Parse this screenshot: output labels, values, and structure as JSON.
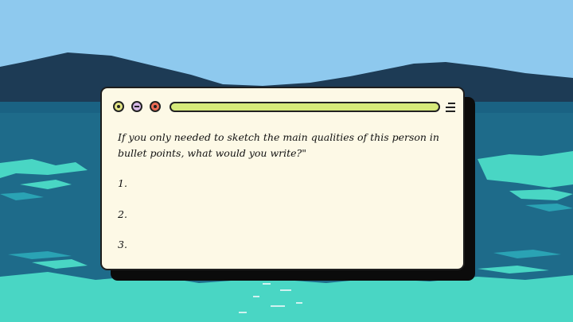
{
  "window": {
    "controls": [
      "yellow-dot",
      "purple-dot",
      "red-dot"
    ],
    "menu_icon": "hamburger-icon",
    "prompt": "If you only needed to sketch the main qualities of this person in bullet points, what would you write?\"",
    "bullets": [
      "1.",
      "2.",
      "3."
    ]
  },
  "colors": {
    "sky": "#8ec9ee",
    "mountains": "#1d3b55",
    "sea": "#1e6b8a",
    "foam": "#49d6c4",
    "window_bg": "#fdf9e6",
    "address_bar": "#d6ea7a"
  }
}
